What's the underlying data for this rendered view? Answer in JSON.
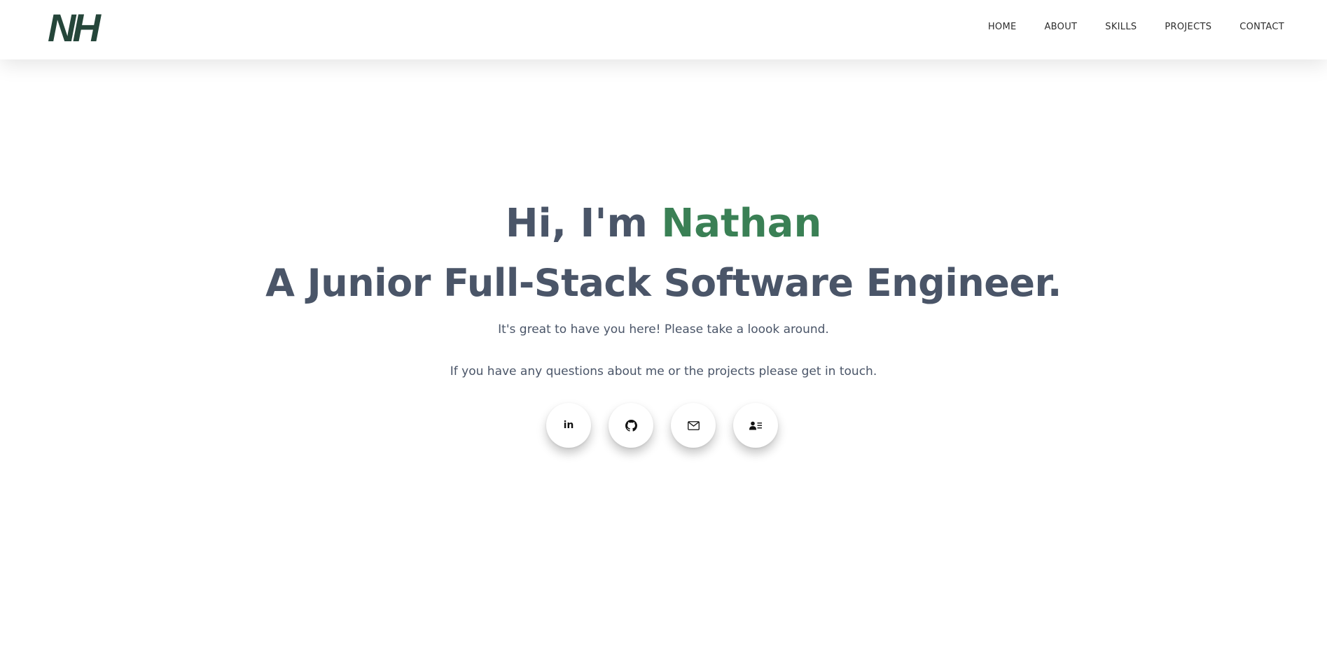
{
  "brand": {
    "logo_text": "NH",
    "logo_color": "#25463a"
  },
  "nav": {
    "items": [
      {
        "label": "HOME"
      },
      {
        "label": "ABOUT"
      },
      {
        "label": "SKILLS"
      },
      {
        "label": "PROJECTS"
      },
      {
        "label": "CONTACT"
      }
    ]
  },
  "hero": {
    "greeting_prefix": "Hi, I'm ",
    "name": "Nathan",
    "role": "A Junior Full-Stack Software Engineer.",
    "subtitle": "It's great to have you here! Please take a loook around.",
    "contact_line": "If you have any questions about me or the projects please get in touch."
  },
  "social": {
    "buttons": [
      {
        "icon": "linkedin-icon",
        "glyph": "in"
      },
      {
        "icon": "github-icon"
      },
      {
        "icon": "mail-icon"
      },
      {
        "icon": "contact-card-icon"
      }
    ]
  },
  "colors": {
    "accent": "#3a8055",
    "text": "#4a5568",
    "nav_text": "#2d2d2d",
    "background": "#ffffff"
  }
}
